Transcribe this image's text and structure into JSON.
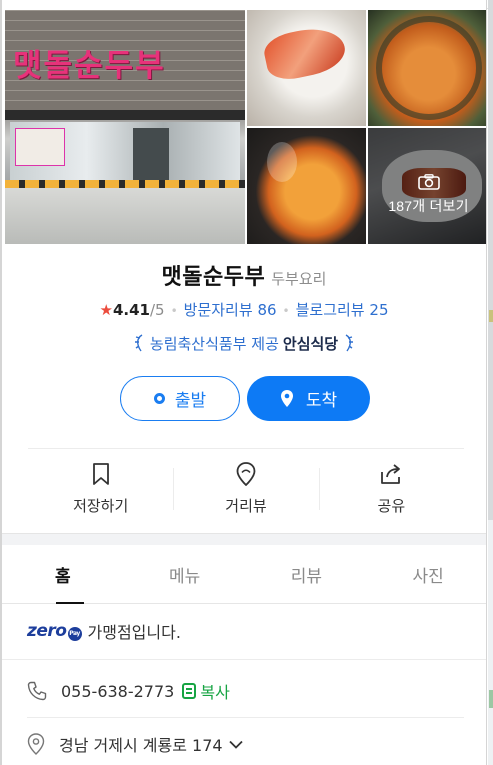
{
  "place": {
    "name": "맷돌순두부",
    "category": "두부요리",
    "rating": "4.41",
    "rating_max": "/5",
    "visitor_reviews_label": "방문자리뷰",
    "visitor_reviews_count": "86",
    "blog_reviews_label": "블로그리뷰",
    "blog_reviews_count": "25",
    "certification": "농림축산식품부 제공",
    "certification_brand": "안심식당",
    "sign_text": "맷돌순두부"
  },
  "photos": {
    "more_label": "187개 더보기"
  },
  "buttons": {
    "start": "출발",
    "arrive": "도착"
  },
  "actions": [
    {
      "label": "저장하기",
      "icon": "bookmark-icon"
    },
    {
      "label": "거리뷰",
      "icon": "street-view-pin-icon"
    },
    {
      "label": "공유",
      "icon": "share-icon"
    }
  ],
  "tabs": [
    {
      "label": "홈",
      "active": true
    },
    {
      "label": "메뉴",
      "active": false
    },
    {
      "label": "리뷰",
      "active": false
    },
    {
      "label": "사진",
      "active": false
    }
  ],
  "info": {
    "zero_logo": "zero",
    "zero_pay": "Pay",
    "zero_text": "가맹점입니다.",
    "phone": "055-638-2773",
    "copy_label": "복사",
    "address": "경남 거제시 계룡로 174"
  },
  "colors": {
    "accent": "#0d7af5",
    "review_link": "#2e6fcf",
    "star": "#ec4c3d",
    "copy": "#17a443",
    "sign": "#e7327a"
  }
}
